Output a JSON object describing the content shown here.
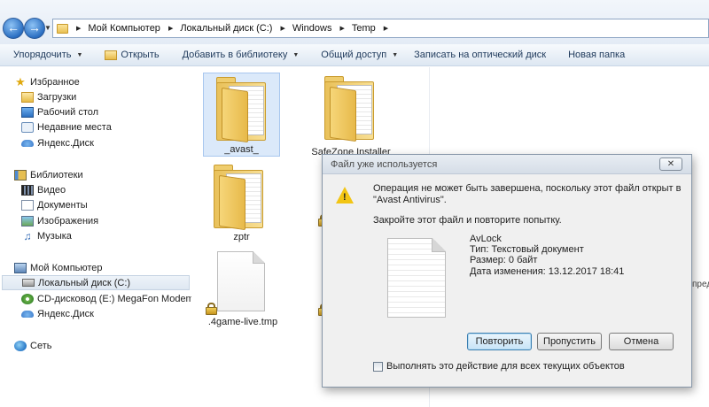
{
  "addressbar": {
    "breadcrumbs": [
      "Мой Компьютер",
      "Локальный диск (C:)",
      "Windows",
      "Temp"
    ]
  },
  "toolbar": {
    "organize": "Упорядочить",
    "open": "Открыть",
    "add_to_library": "Добавить в библиотеку",
    "share": "Общий доступ",
    "burn": "Записать на оптический диск",
    "new_folder": "Новая папка"
  },
  "navpane": {
    "favorites": "Избранное",
    "downloads": "Загрузки",
    "desktop": "Рабочий стол",
    "recent": "Недавние места",
    "yandex_disk": "Яндекс.Диск",
    "libraries": "Библиотеки",
    "video": "Видео",
    "documents": "Документы",
    "images": "Изображения",
    "music": "Музыка",
    "computer": "Мой Компьютер",
    "local_disk": "Локальный диск (C:)",
    "cd_drive": "CD-дисковод (E:) MegaFon Modem",
    "yandex_disk2": "Яндекс.Диск",
    "network": "Сеть"
  },
  "files": {
    "avast": "_avast_",
    "safezone": "SafeZone Installer",
    "zptr": "zptr",
    "tmp": ".4game-live.tmp",
    "clipped_text": "пред"
  },
  "dialog": {
    "title": "Файл уже используется",
    "message_line1": "Операция не может быть завершена, поскольку этот файл открыт в",
    "message_line2": "\"Avast Antivirus\".",
    "message2": "Закройте этот файл и повторите попытку.",
    "file_name": "AvLock",
    "file_type": "Тип: Текстовый документ",
    "file_size": "Размер: 0 байт",
    "file_modified": "Дата изменения: 13.12.2017 18:41",
    "retry": "Повторить",
    "skip": "Пропустить",
    "cancel": "Отмена",
    "checkbox_label": "Выполнять это действие для всех текущих объектов",
    "close_glyph": "✕"
  }
}
